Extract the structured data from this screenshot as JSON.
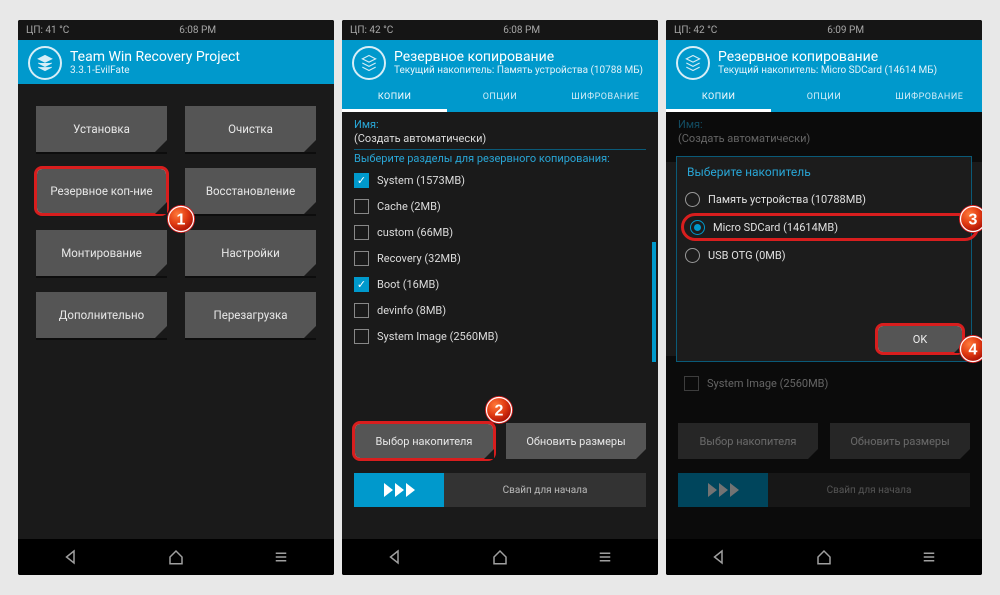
{
  "screen1": {
    "status_left": "ЦП: 41 °C",
    "status_center": "6:08 PM",
    "title": "Team Win Recovery Project",
    "subtitle": "3.3.1-EvilFate",
    "buttons": {
      "install": "Установка",
      "wipe": "Очистка",
      "backup": "Резервное коп-ние",
      "restore": "Восстановление",
      "mount": "Монтирование",
      "settings": "Настройки",
      "advanced": "Дополнительно",
      "reboot": "Перезагрузка"
    }
  },
  "screen2": {
    "status_left": "ЦП: 42 °C",
    "status_center": "6:08 PM",
    "title": "Резервное копирование",
    "subtitle": "Текущий накопитель: Память устройства (10788 МБ)",
    "tabs": {
      "t1": "КОПИИ",
      "t2": "ОПЦИИ",
      "t3": "ШИФРОВАНИЕ"
    },
    "name_label": "Имя:",
    "name_value": "(Создать автоматически)",
    "select_label": "Выберите разделы для резервного копирования:",
    "parts": [
      {
        "label": "System (1573MB)",
        "on": true
      },
      {
        "label": "Cache (2MB)",
        "on": false
      },
      {
        "label": "custom (66MB)",
        "on": false
      },
      {
        "label": "Recovery (32MB)",
        "on": false
      },
      {
        "label": "Boot (16MB)",
        "on": true
      },
      {
        "label": "devinfo (8MB)",
        "on": false
      },
      {
        "label": "System Image (2560MB)",
        "on": false
      }
    ],
    "btn_storage": "Выбор накопителя",
    "btn_refresh": "Обновить размеры",
    "swipe": "Свайп для начала"
  },
  "screen3": {
    "status_left": "ЦП: 42 °C",
    "status_center": "6:09 PM",
    "title": "Резервное копирование",
    "subtitle": "Текущий накопитель: Micro SDCard (14614 МБ)",
    "tabs": {
      "t1": "КОПИИ",
      "t2": "ОПЦИИ",
      "t3": "ШИФРОВАНИЕ"
    },
    "name_label": "Имя:",
    "name_value": "(Создать автоматически)",
    "modal_title": "Выберите накопитель",
    "radios": [
      {
        "label": "Память устройства (10788MB)",
        "on": false
      },
      {
        "label": "Micro SDCard (14614MB)",
        "on": true
      },
      {
        "label": "USB OTG (0MB)",
        "on": false
      }
    ],
    "ok": "OK",
    "system_image": "System Image (2560MB)",
    "btn_storage": "Выбор накопителя",
    "btn_refresh": "Обновить размеры",
    "swipe": "Свайп для начала"
  },
  "badges": {
    "b1": "1",
    "b2": "2",
    "b3": "3",
    "b4": "4"
  }
}
